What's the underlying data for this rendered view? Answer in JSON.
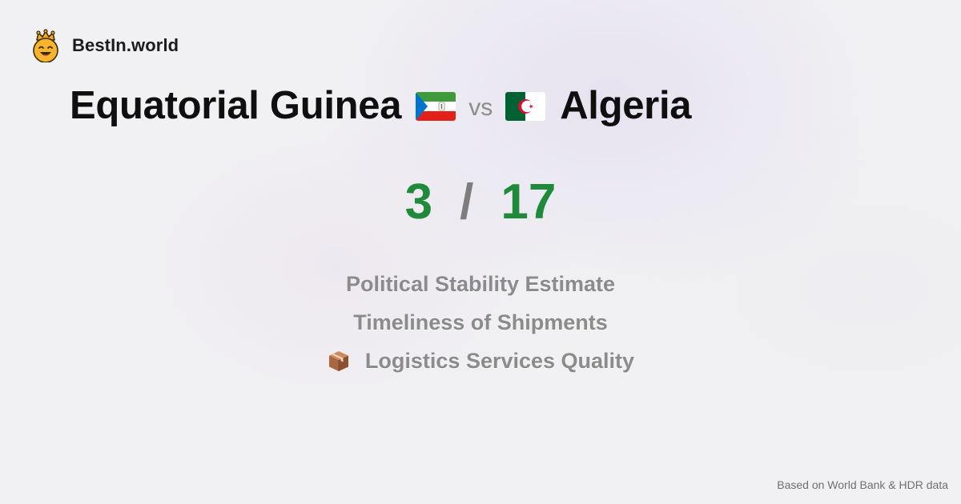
{
  "brand": {
    "name": "BestIn.world",
    "logo_icon": "crowned-smiley-icon"
  },
  "comparison": {
    "left_country": "Equatorial Guinea",
    "left_flag_icon": "equatorial-guinea-flag-icon",
    "vs_label": "vs",
    "right_country": "Algeria",
    "right_flag_icon": "algeria-flag-icon"
  },
  "score": {
    "left": "3",
    "separator": "/",
    "right": "17"
  },
  "metrics": [
    {
      "label": "Political Stability Estimate",
      "icon": ""
    },
    {
      "label": "Timeliness of Shipments",
      "icon": ""
    },
    {
      "label": "Logistics Services Quality",
      "icon": "package-box-icon"
    }
  ],
  "footer": {
    "source": "Based on World Bank & HDR data"
  },
  "colors": {
    "score": "#1f8a3a",
    "separator": "#7d7d7d",
    "metric_text": "#8b8b8b",
    "background": "#f1f1f3"
  }
}
